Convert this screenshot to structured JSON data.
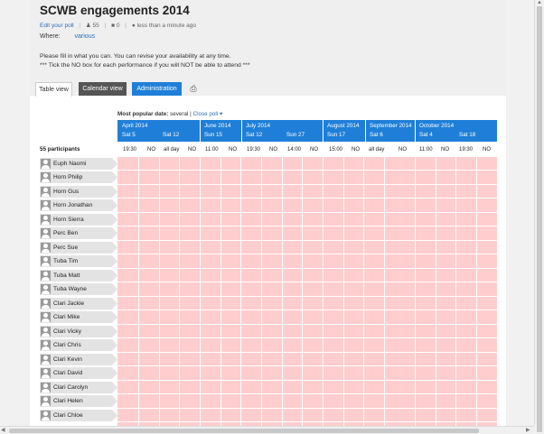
{
  "poll": {
    "title": "SCWB engagements 2014",
    "edit_link": "Edit your poll",
    "participants_icon_count": "55",
    "comments_count": "0",
    "time_ago": "less than a minute ago",
    "where_label": "Where:",
    "where_value": "various",
    "instruction_1": "Please fill in what you can. You can revise your availability at any time.",
    "instruction_2": "*** Tick the NO box for each performance if you will NOT be able to attend ***"
  },
  "tabs": {
    "table": "Table view",
    "calendar": "Calendar view",
    "admin": "Administration"
  },
  "popular": {
    "label": "Most popular date:",
    "value": "several",
    "close": "Close poll"
  },
  "months": [
    "April 2014",
    "June 2014",
    "July 2014",
    "August 2014",
    "September 2014",
    "October 2014"
  ],
  "dates": [
    "Sat 5",
    "Sat 12",
    "Sun 15",
    "Sat 12",
    "Sun 27",
    "Sun 17",
    "Sat 6",
    "Sat 4",
    "Sat 18"
  ],
  "options": [
    "19:30",
    "NO",
    "all day",
    "NO",
    "11:00",
    "NO",
    "19:30",
    "NO",
    "14:00",
    "NO",
    "15:00",
    "NO",
    "all day",
    "NO",
    "11:00",
    "NO",
    "19:30",
    "NO"
  ],
  "participants_count": "55 participants",
  "participants": [
    "Euph Naomi",
    "Horn Philip",
    "Horn Gus",
    "Horn Jonathan",
    "Horn Sierra",
    "Perc Ben",
    "Perc Sue",
    "Tuba Tim",
    "Tuba Matt",
    "Tuba Wayne",
    "Clari Jackie",
    "Clari Mike",
    "Clari Vicky",
    "Clari Chris",
    "Clari Kevin",
    "Clari David",
    "Clari Carolyn",
    "Clari Helen",
    "Clari Chloe"
  ],
  "colors": {
    "header_blue": "#1f7fd8",
    "cell_no_answer": "#ffcdcd",
    "calendar_tab": "#555555"
  }
}
